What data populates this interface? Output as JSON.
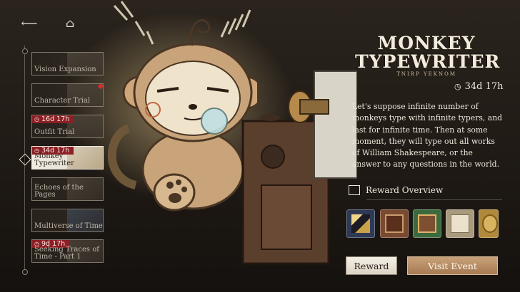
{
  "nav": {
    "back_icon": "back-arrow-icon",
    "home_icon": "home-icon"
  },
  "events": [
    {
      "label": "Vision Expansion",
      "timer": null,
      "selected": false,
      "badge": false
    },
    {
      "label": "Character Trial",
      "timer": null,
      "selected": false,
      "badge": true
    },
    {
      "label": "Outfit Trial",
      "timer": "16d 17h",
      "selected": false,
      "badge": false
    },
    {
      "label": "Monkey Typewriter",
      "timer": "34d 17h",
      "selected": true,
      "badge": false
    },
    {
      "label": "Echoes of the Pages",
      "timer": null,
      "selected": false,
      "badge": false
    },
    {
      "label": "Multiverse of Time",
      "timer": null,
      "selected": false,
      "badge": false
    },
    {
      "label": "Seeking Traces of Time - Part 1",
      "timer": "9d 17h",
      "selected": false,
      "badge": false
    }
  ],
  "event_detail": {
    "logo_line1": "MONKEY",
    "logo_line2": "TYPEWRITER",
    "logo_sub": "TNIRP YEKNOM",
    "timer": "34d 17h",
    "description": "Let's suppose infinite number of monkeys type with infinite typers, and last for infinite time. Then at some moment, they will type out all works of William Shakespeare, or the answer to any questions in the world.",
    "reward_overview_label": "Reward Overview",
    "rewards": [
      {
        "icon": "quill-pen-icon",
        "color": "#2e3a55"
      },
      {
        "icon": "book-icon",
        "color": "#7a4a30"
      },
      {
        "icon": "chest-icon",
        "color": "#3b6a3e"
      },
      {
        "icon": "scroll-icon",
        "color": "#a99a7e"
      },
      {
        "icon": "coin-icon",
        "color": "#b08a3a"
      }
    ],
    "reward_button": "Reward",
    "visit_button": "Visit Event"
  },
  "colors": {
    "timer_red": "#8b1f24",
    "accent_gold": "#b88b62",
    "panel_text": "#ece6da"
  }
}
